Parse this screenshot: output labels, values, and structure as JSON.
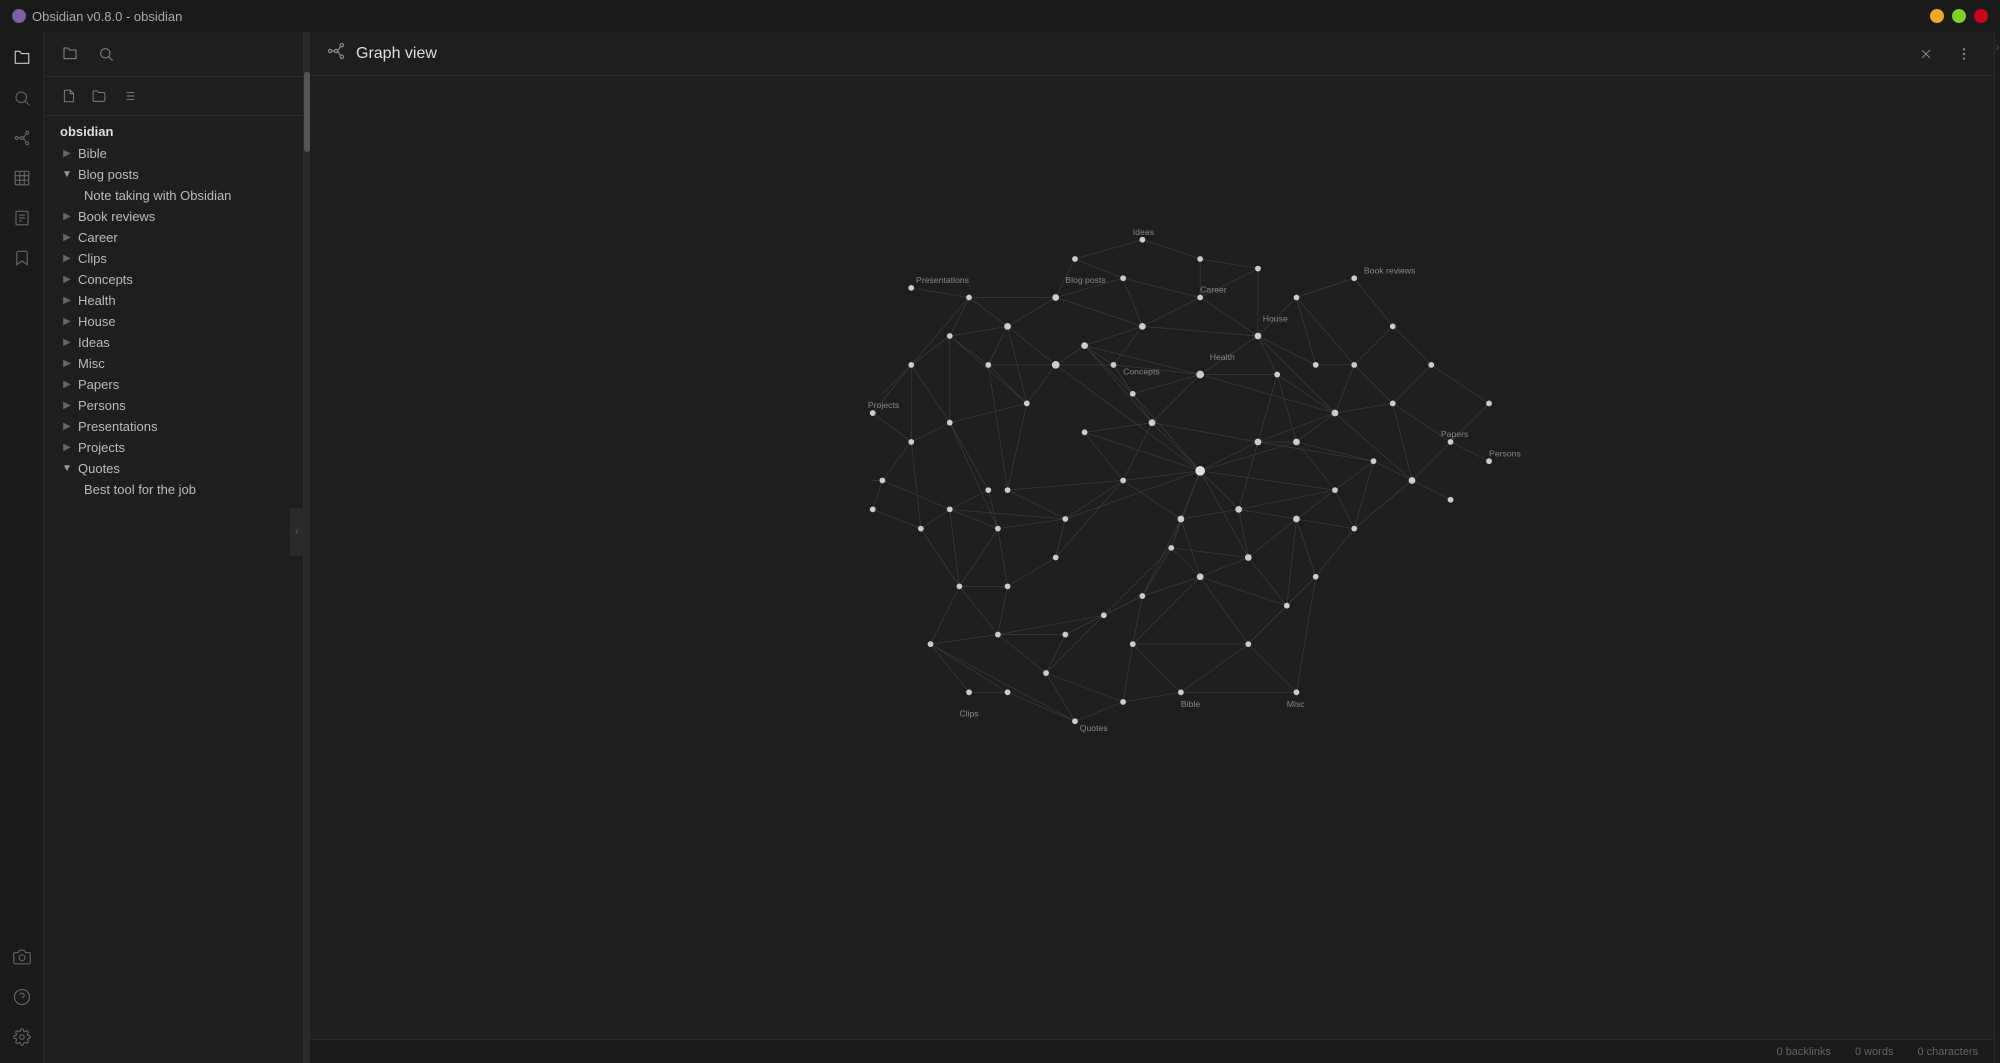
{
  "titlebar": {
    "title": "Obsidian v0.8.0 - obsidian",
    "icon_label": "obsidian-app-icon"
  },
  "activity_bar": {
    "icons": [
      {
        "name": "files-icon",
        "symbol": "📁",
        "tooltip": "Files"
      },
      {
        "name": "search-icon",
        "symbol": "🔍",
        "tooltip": "Search"
      },
      {
        "name": "graph-icon",
        "symbol": "⬡",
        "tooltip": "Graph view"
      },
      {
        "name": "table-icon",
        "symbol": "⊞",
        "tooltip": "Table"
      },
      {
        "name": "notes-icon",
        "symbol": "📋",
        "tooltip": "Notes"
      },
      {
        "name": "bookmark-icon",
        "symbol": "🔖",
        "tooltip": "Bookmarks"
      }
    ],
    "bottom_icons": [
      {
        "name": "camera-icon",
        "symbol": "📷",
        "tooltip": "Camera"
      },
      {
        "name": "help-icon",
        "symbol": "?",
        "tooltip": "Help"
      },
      {
        "name": "settings-icon",
        "symbol": "⚙",
        "tooltip": "Settings"
      }
    ]
  },
  "explorer": {
    "vault_name": "obsidian",
    "toolbar": {
      "new_file_label": "New file",
      "new_folder_label": "New folder",
      "sort_label": "Sort"
    },
    "tree": [
      {
        "id": "bible",
        "label": "Bible",
        "type": "folder",
        "open": false,
        "children": []
      },
      {
        "id": "blog-posts",
        "label": "Blog posts",
        "type": "folder",
        "open": true,
        "children": [
          {
            "id": "note-taking",
            "label": "Note taking with Obsidian",
            "type": "file"
          }
        ]
      },
      {
        "id": "book-reviews",
        "label": "Book reviews",
        "type": "folder",
        "open": false,
        "children": []
      },
      {
        "id": "career",
        "label": "Career",
        "type": "folder",
        "open": false,
        "children": []
      },
      {
        "id": "clips",
        "label": "Clips",
        "type": "folder",
        "open": false,
        "children": []
      },
      {
        "id": "concepts",
        "label": "Concepts",
        "type": "folder",
        "open": false,
        "children": []
      },
      {
        "id": "health",
        "label": "Health",
        "type": "folder",
        "open": false,
        "children": []
      },
      {
        "id": "house",
        "label": "House",
        "type": "folder",
        "open": false,
        "children": []
      },
      {
        "id": "ideas",
        "label": "Ideas",
        "type": "folder",
        "open": false,
        "children": []
      },
      {
        "id": "misc",
        "label": "Misc",
        "type": "folder",
        "open": false,
        "children": []
      },
      {
        "id": "papers",
        "label": "Papers",
        "type": "folder",
        "open": false,
        "children": []
      },
      {
        "id": "persons",
        "label": "Persons",
        "type": "folder",
        "open": false,
        "children": []
      },
      {
        "id": "presentations",
        "label": "Presentations",
        "type": "folder",
        "open": false,
        "children": []
      },
      {
        "id": "projects",
        "label": "Projects",
        "type": "folder",
        "open": false,
        "children": []
      },
      {
        "id": "quotes",
        "label": "Quotes",
        "type": "folder",
        "open": true,
        "children": [
          {
            "id": "best-tool",
            "label": "Best tool for the job",
            "type": "file"
          }
        ]
      }
    ]
  },
  "graph_view": {
    "title": "Graph view",
    "close_label": "Close",
    "more_options_label": "More options"
  },
  "status_bar": {
    "backlinks": "0 backlinks",
    "words": "0 words",
    "characters": "0 characters"
  },
  "colors": {
    "node": "#cccccc",
    "edge": "#555555",
    "bg": "#1e1e1e",
    "accent": "#7b5ea7"
  }
}
